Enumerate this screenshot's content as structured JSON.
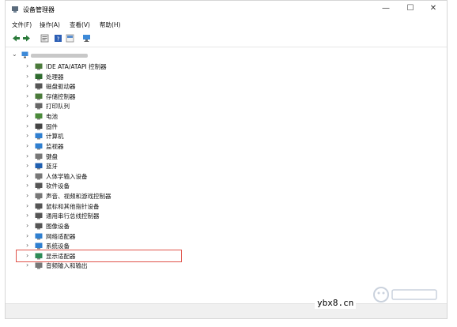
{
  "window": {
    "title": "设备管理器",
    "minimize": "—",
    "maximize": "☐",
    "close": "✕"
  },
  "menu": [
    "文件(F)",
    "操作(A)",
    "查看(V)",
    "帮助(H)"
  ],
  "tree_items": [
    {
      "label": "IDE ATA/ATAPI 控制器",
      "icon": "ide-controller-icon",
      "color": "#4a7a3a"
    },
    {
      "label": "处理器",
      "icon": "processor-icon",
      "color": "#2e6b2e"
    },
    {
      "label": "磁盘驱动器",
      "icon": "disk-drive-icon",
      "color": "#555555"
    },
    {
      "label": "存储控制器",
      "icon": "storage-controller-icon",
      "color": "#4a7a3a"
    },
    {
      "label": "打印队列",
      "icon": "printer-icon",
      "color": "#666666"
    },
    {
      "label": "电池",
      "icon": "battery-icon",
      "color": "#4a8a3a"
    },
    {
      "label": "固件",
      "icon": "firmware-icon",
      "color": "#444444"
    },
    {
      "label": "计算机",
      "icon": "computer-icon",
      "color": "#2f7fd0"
    },
    {
      "label": "监视器",
      "icon": "monitor-icon",
      "color": "#2f7fd0"
    },
    {
      "label": "键盘",
      "icon": "keyboard-icon",
      "color": "#777777"
    },
    {
      "label": "蓝牙",
      "icon": "bluetooth-icon",
      "color": "#1f5fb0"
    },
    {
      "label": "人体学输入设备",
      "icon": "hid-icon",
      "color": "#777777"
    },
    {
      "label": "软件设备",
      "icon": "software-device-icon",
      "color": "#555555"
    },
    {
      "label": "声音、视频和游戏控制器",
      "icon": "sound-icon",
      "color": "#777777"
    },
    {
      "label": "鼠标和其他指针设备",
      "icon": "mouse-icon",
      "color": "#555555"
    },
    {
      "label": "通用串行总线控制器",
      "icon": "usb-icon",
      "color": "#555555"
    },
    {
      "label": "图像设备",
      "icon": "camera-icon",
      "color": "#555555"
    },
    {
      "label": "网络适配器",
      "icon": "network-adapter-icon",
      "color": "#2f7fd0"
    },
    {
      "label": "系统设备",
      "icon": "system-device-icon",
      "color": "#2f7fd0"
    },
    {
      "label": "显示适配器",
      "icon": "display-adapter-icon",
      "color": "#2e8b57"
    },
    {
      "label": "音频输入和输出",
      "icon": "audio-io-icon",
      "color": "#777777"
    }
  ],
  "highlight_color": "#e0534a",
  "watermark": {
    "url": "ybx8.cn"
  }
}
